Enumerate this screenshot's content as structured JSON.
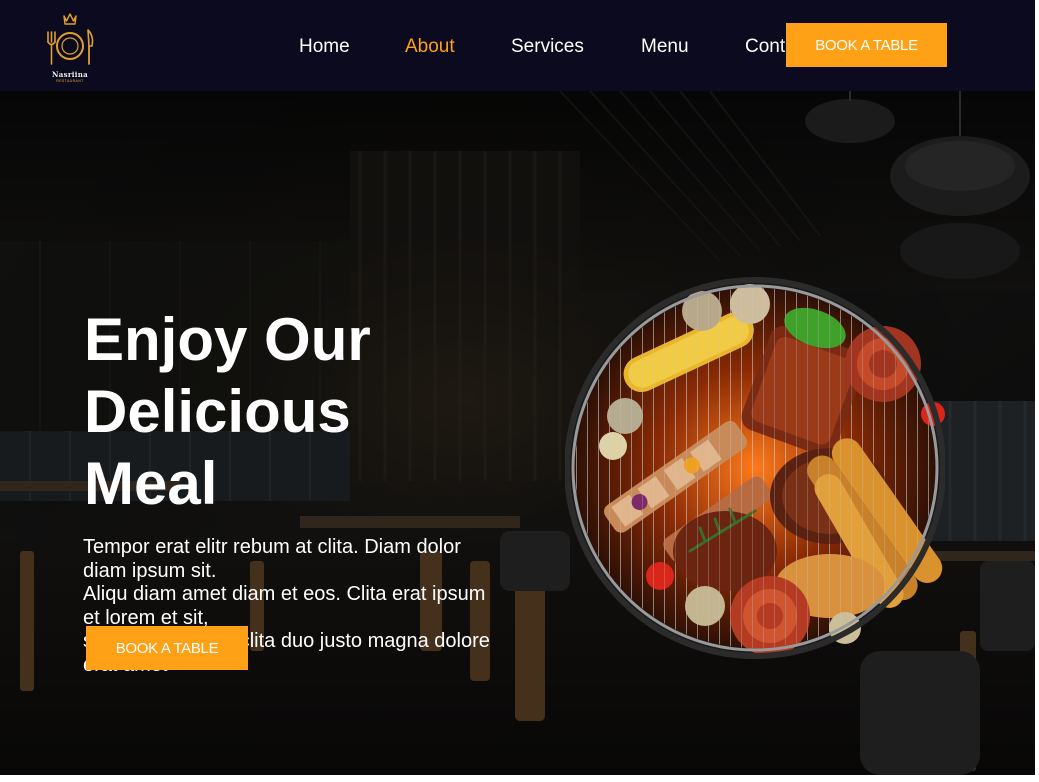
{
  "brand": {
    "name": "Nasriina",
    "tagline": "RESTAURANT"
  },
  "nav": {
    "items": [
      {
        "label": "Home",
        "active": false
      },
      {
        "label": "About",
        "active": true
      },
      {
        "label": "Services",
        "active": false
      },
      {
        "label": "Menu",
        "active": false
      },
      {
        "label": "Contact",
        "active": false
      }
    ],
    "cta_label": "BOOK A TABLE"
  },
  "hero": {
    "title_lines": [
      "Enjoy Our",
      "Delicious",
      "Meal"
    ],
    "text_lines": [
      "Tempor erat elitr rebum at clita. Diam dolor diam ipsum sit.",
      "Aliqu diam amet diam et eos. Clita erat ipsum et lorem et sit,",
      "sed stet lorem sit clita duo justo magna dolore erat amet"
    ],
    "cta_label": "BOOK A TABLE"
  },
  "colors": {
    "accent": "#fea116",
    "nav_bg": "#0b0a1e",
    "text": "#ffffff"
  },
  "icons": {
    "logo": "crown-fork-plate-knife-icon"
  }
}
